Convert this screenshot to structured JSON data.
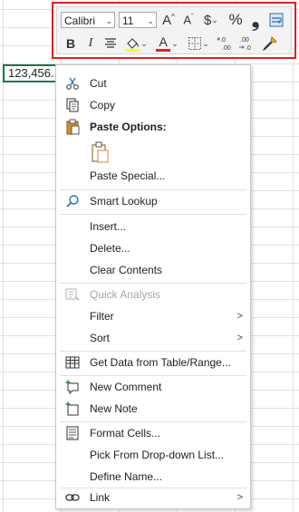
{
  "cell": {
    "value": "123,456."
  },
  "mini_toolbar": {
    "font_name": "Calibri",
    "font_size": "11",
    "increase_font_glyph": "A",
    "decrease_font_glyph": "A",
    "currency_glyph": "$",
    "percent_glyph": "%",
    "comma_glyph": "❟",
    "bold_glyph": "B",
    "italic_glyph": "I",
    "font_color_glyph": "A",
    "increase_decimal_glyph": "←.0 .00",
    "decrease_decimal_glyph": ".00 →.0",
    "highlight_color": "#ffff00",
    "font_color": "#e02020",
    "outline_color": "#e02020"
  },
  "menu": {
    "cut": "Cut",
    "copy": "Copy",
    "paste_options": "Paste Options:",
    "paste_special": "Paste Special...",
    "smart_lookup": "Smart Lookup",
    "insert": "Insert...",
    "delete": "Delete...",
    "clear_contents": "Clear Contents",
    "quick_analysis": "Quick Analysis",
    "filter": "Filter",
    "sort": "Sort",
    "get_data": "Get Data from Table/Range...",
    "new_comment": "New Comment",
    "new_note": "New Note",
    "format_cells": "Format Cells...",
    "pick_dropdown": "Pick From Drop-down List...",
    "define_name": "Define Name...",
    "link": "Link"
  }
}
